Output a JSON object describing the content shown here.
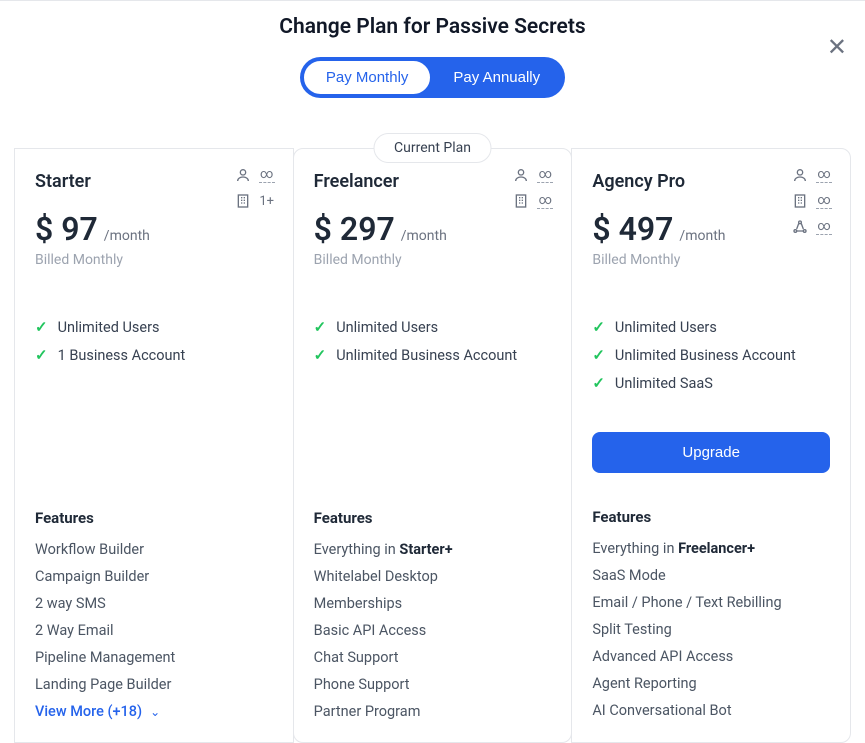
{
  "title": "Change Plan for Passive Secrets",
  "toggle": {
    "monthly": "Pay Monthly",
    "annually": "Pay Annually"
  },
  "current_plan_label": "Current Plan",
  "infinity": "∞",
  "plans": [
    {
      "name": "Starter",
      "price": "$ 97",
      "per": "/month",
      "billed": "Billed Monthly",
      "limits": {
        "users": "∞",
        "businesses": "1+"
      },
      "checks": [
        "Unlimited Users",
        "1 Business Account"
      ],
      "features_title": "Features",
      "everything_in": "",
      "features": [
        "Workflow Builder",
        "Campaign Builder",
        "2 way SMS",
        "2 Way Email",
        "Pipeline Management",
        "Landing Page Builder"
      ],
      "view_more": "View More (+18)"
    },
    {
      "name": "Freelancer",
      "price": "$ 297",
      "per": "/month",
      "billed": "Billed Monthly",
      "limits": {
        "users": "∞",
        "businesses": "∞"
      },
      "checks": [
        "Unlimited Users",
        "Unlimited Business Account"
      ],
      "features_title": "Features",
      "everything_prefix": "Everything in ",
      "everything_in": "Starter+",
      "features": [
        "Whitelabel Desktop",
        "Memberships",
        "Basic API Access",
        "Chat Support",
        "Phone Support",
        "Partner Program"
      ]
    },
    {
      "name": "Agency Pro",
      "price": "$ 497",
      "per": "/month",
      "billed": "Billed Monthly",
      "limits": {
        "users": "∞",
        "businesses": "∞",
        "saas": "∞"
      },
      "checks": [
        "Unlimited Users",
        "Unlimited Business Account",
        "Unlimited SaaS"
      ],
      "upgrade": "Upgrade",
      "features_title": "Features",
      "everything_prefix": "Everything in ",
      "everything_in": "Freelancer+",
      "features": [
        "SaaS Mode",
        "Email / Phone / Text Rebilling",
        "Split Testing",
        "Advanced API Access",
        "Agent Reporting",
        "AI Conversational Bot"
      ]
    }
  ]
}
